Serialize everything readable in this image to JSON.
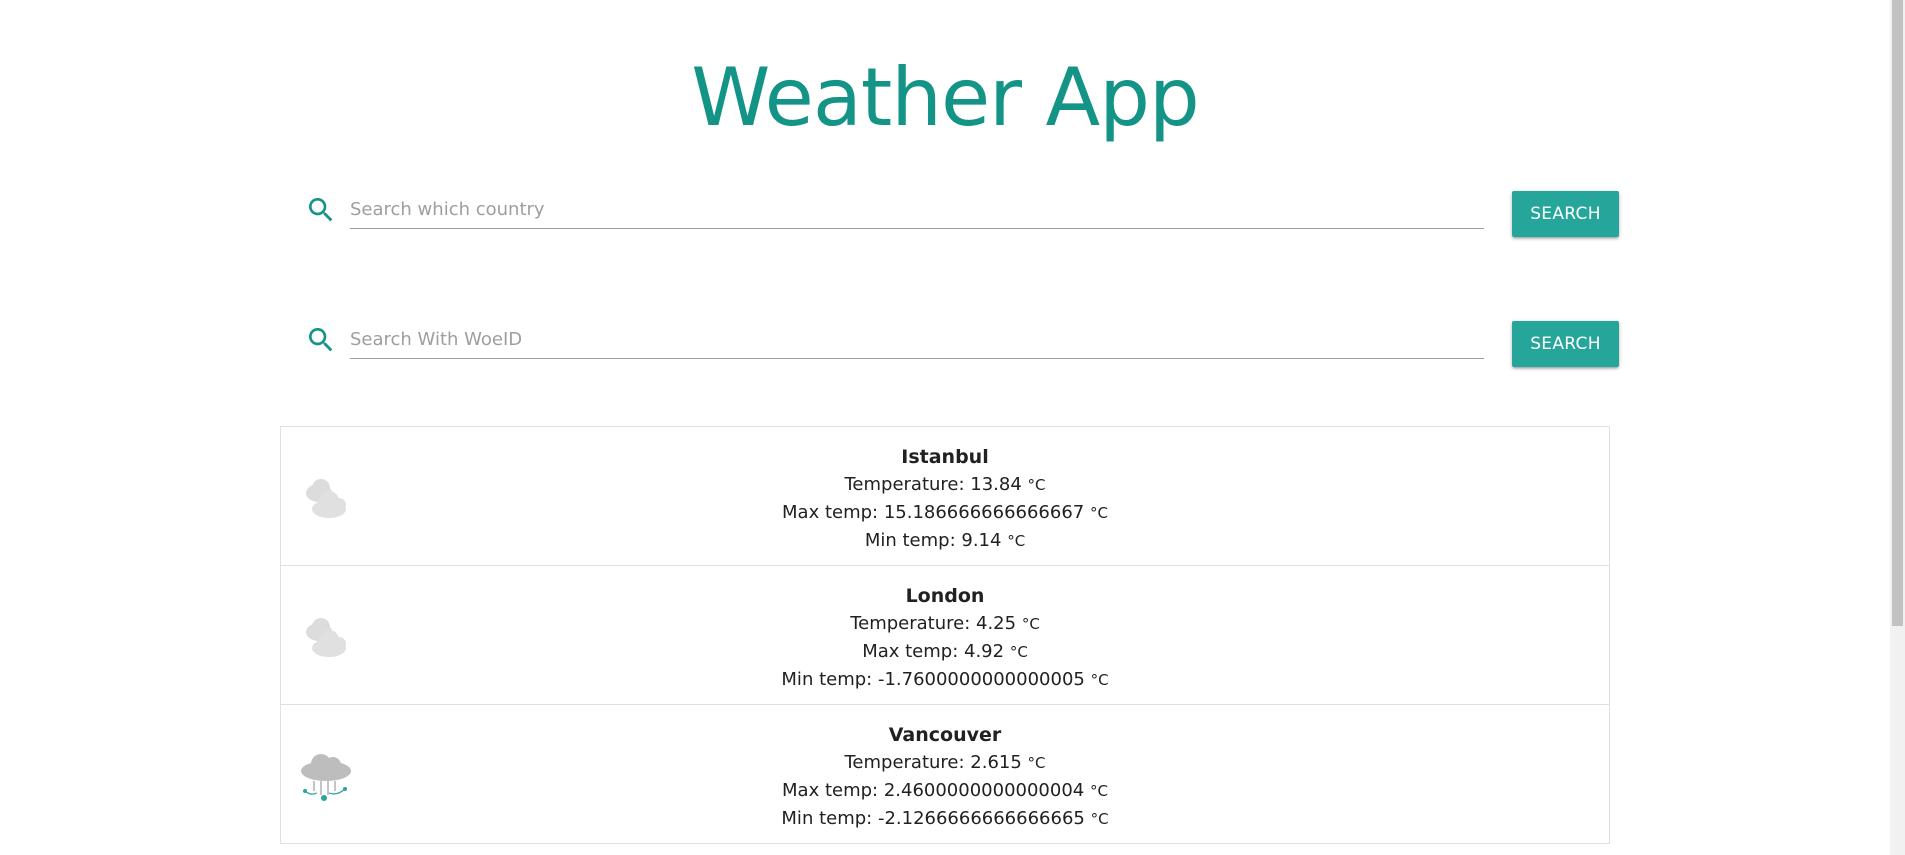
{
  "header": {
    "title": "Weather App"
  },
  "search_country": {
    "placeholder": "Search which country",
    "button_label": "SEARCH"
  },
  "search_woeid": {
    "placeholder": "Search With WoeID",
    "button_label": "SEARCH"
  },
  "unit": "°C",
  "results": [
    {
      "city": "Istanbul",
      "icon": "heavy-cloud-icon",
      "temperature_label": "Temperature: 13.84",
      "max_label": "Max temp: 15.186666666666667",
      "min_label": "Min temp: 9.14"
    },
    {
      "city": "London",
      "icon": "heavy-cloud-icon",
      "temperature_label": "Temperature: 4.25",
      "max_label": "Max temp: 4.92",
      "min_label": "Min temp: -1.7600000000000005"
    },
    {
      "city": "Vancouver",
      "icon": "sleet-icon",
      "temperature_label": "Temperature: 2.615",
      "max_label": "Max temp: 2.4600000000000004",
      "min_label": "Min temp: -2.1266666666666665"
    }
  ],
  "colors": {
    "accent": "#139487",
    "button": "#26a69a"
  }
}
